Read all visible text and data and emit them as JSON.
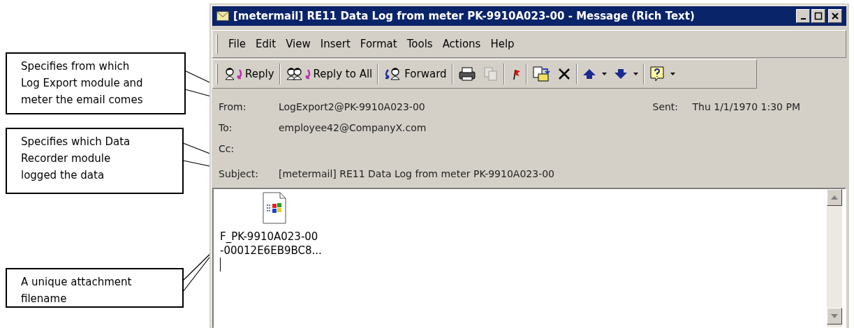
{
  "callouts": [
    {
      "text": "Specifies from which\nLog Export module and\nmeter the email comes"
    },
    {
      "text": "Specifies which Data\nRecorder module\nlogged the data"
    },
    {
      "text": "A unique attachment\nfilename"
    }
  ],
  "window": {
    "title": "[metermail] RE11 Data Log from meter PK-9910A023-00 - Message (Rich Text)"
  },
  "menu": [
    "File",
    "Edit",
    "View",
    "Insert",
    "Format",
    "Tools",
    "Actions",
    "Help"
  ],
  "toolbar": {
    "text_buttons": [
      {
        "label": "Reply"
      },
      {
        "label": "Reply to All"
      },
      {
        "label": "Forward"
      }
    ],
    "icon_buttons": [
      {
        "disabled": false
      },
      {
        "disabled": true
      },
      {
        "disabled": false
      },
      {
        "disabled": false
      },
      {
        "disabled": false
      },
      {
        "disabled": false
      },
      {
        "disabled": false
      },
      {
        "disabled": false
      }
    ]
  },
  "header": {
    "fields": [
      {
        "label": "From:",
        "value": "LogExport2@PK-9910A023-00"
      },
      {
        "label": "To:",
        "value": "employee42@CompanyX.com"
      },
      {
        "label": "Cc:"
      },
      {
        "label": "Subject:",
        "value": "[metermail] RE11 Data Log from meter PK-9910A023-00"
      }
    ],
    "sent": {
      "label": "Sent:",
      "value": "Thu 1/1/1970 1:30 PM"
    }
  },
  "attachment": {
    "name_lines": [
      "F_PK-9910A023-00",
      "-00012E6EB9BC8..."
    ]
  }
}
